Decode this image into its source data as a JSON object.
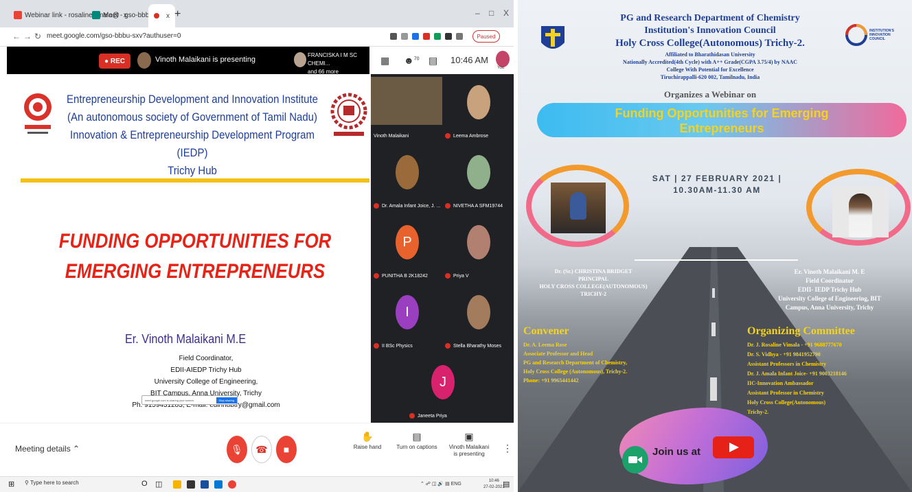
{
  "browser": {
    "tabs": [
      {
        "label": "Webinar link - rosalinevimala@",
        "close": "x"
      },
      {
        "label": "Meet - gso-bbbu-sxv",
        "close": "x"
      },
      {
        "label": "",
        "close": "x"
      }
    ],
    "new_tab": "+",
    "window_controls": [
      "–",
      "□",
      "X"
    ],
    "url": "meet.google.com/gso-bbbu-sxv?authuser=0",
    "paused_label": "Paused"
  },
  "meet": {
    "rec_label": "REC",
    "presenting_text": "Vinoth Malaikani is presenting",
    "attendees_line1": "FRANCISKA I M SC CHEMI...",
    "attendees_line2": "and 66 more",
    "participant_count": "70",
    "time": "10:46 AM",
    "you_label": "You",
    "participants": [
      {
        "name": "Vinoth Malaikani",
        "initial": "",
        "color": "#6b5a44"
      },
      {
        "name": "Leema Ambrose",
        "initial": "",
        "color": "#c8a17d"
      },
      {
        "name": "Dr. Amala Infant Joice, J. ...",
        "initial": "",
        "color": "#9a6a3a"
      },
      {
        "name": "NIVETHA A SFM19744",
        "initial": "",
        "color": "#8fb08a"
      },
      {
        "name": "PUNITHA B 2K18242",
        "initial": "P",
        "color": "#e8622d"
      },
      {
        "name": "Priya V",
        "initial": "",
        "color": "#b28070"
      },
      {
        "name": "II BSc Physics",
        "initial": "I",
        "color": "#9a3fbf"
      },
      {
        "name": "Stella Bharathy Moses",
        "initial": "",
        "color": "#a37b5d"
      },
      {
        "name": "Janeeta Priya",
        "initial": "J",
        "color": "#d9226e"
      }
    ],
    "meeting_details": "Meeting details",
    "raise_hand": "Raise hand",
    "captions": "Turn on captions",
    "presenting_line1": "Vinoth Malaikani",
    "presenting_line2": "is presenting"
  },
  "slide": {
    "header_lines": [
      "Entrepreneurship Development and Innovation Institute",
      "(An autonomous society of Government of Tamil Nadu)",
      "Innovation & Entrepreneurship Development Program (IEDP)",
      "Trichy Hub"
    ],
    "title_line1": "FUNDING OPPORTUNITIES FOR",
    "title_line2": "EMERGING ENTREPRENEURS",
    "speaker_name": "Er. Vinoth Malaikani M.E",
    "info_lines": [
      "Field Coordinator,",
      "EDII-AIEDP Trichy Hub",
      "University College of Engineering,",
      "BIT Campus, Anna University, Trichy",
      "Ph. 9159431283, E-mail: edinhubtry@gmail.com"
    ],
    "share_text": "meet.google.com is sharing your screen.",
    "stop_sharing": "Stop sharing"
  },
  "taskbar": {
    "search": "Type here to search",
    "lang": "ENG",
    "time": "10:46",
    "date": "27-02-2021"
  },
  "poster": {
    "title1": "PG and Research Department of Chemistry",
    "title2": "Institution's Innovation Council",
    "title3": "Holy Cross College(Autonomous) Trichy-2.",
    "sub_lines": [
      "Affiliated to Bharathidasan University",
      "Nationally Accredited(4th Cycle) with A++ Grade(CGPA 3.75/4) by NAAC",
      "College With Potential for Excellence",
      "Tiruchirappalli-620 002, Tamilnadu, India"
    ],
    "organizes": "Organizes a Webinar on",
    "webinar_title_line1": "Funding Opportunities for Emerging",
    "webinar_title_line2": "Entrepreneurs",
    "date_line1": "SAT | 27 FEBRUARY 2021 |",
    "date_line2": "10.30AM-11.30 AM",
    "iic_logo_text": [
      "INSTITUTION'S",
      "INNOVATION",
      "COUNCIL"
    ],
    "principal_lines": [
      "Dr. (Sr.) CHRISTINA BRIDGET",
      "PRINCIPAL",
      "HOLY CROSS COLLEGE(AUTONOMOUS)",
      "TRICHY-2"
    ],
    "speaker_lines": [
      "Er. Vinoth Malaikani M. E",
      "Field Coordinator",
      "EDII- IEDP Trichy Hub",
      "University College of Engineering, BIT",
      "Campus, Anna University, Trichy"
    ],
    "convener_heading": "Convener",
    "convener_lines": [
      "Dr. A. Leema Rose",
      "Associate Professor and Head",
      "PG and Research Department of Chemistry,",
      "Holy Cross College (Autonomous), Trichy-2.",
      "Phone: +91 9965441442"
    ],
    "committee_heading": "Organizing Committee",
    "committee_lines": [
      "Dr. J. Rosaline Vimala - +91 9688777670",
      "Dr. S. Vidhya - +91 9841952790",
      "Assistant Professors in Chemistry",
      "Dr. J. Amala Infant Joice- +91 9003218146",
      "IIC-Innovation Ambassador",
      "Assistant Professor in Chemistry",
      "Holy Cross College(Autonomous)",
      "Trichy-2."
    ],
    "join_text": "Join us at"
  }
}
